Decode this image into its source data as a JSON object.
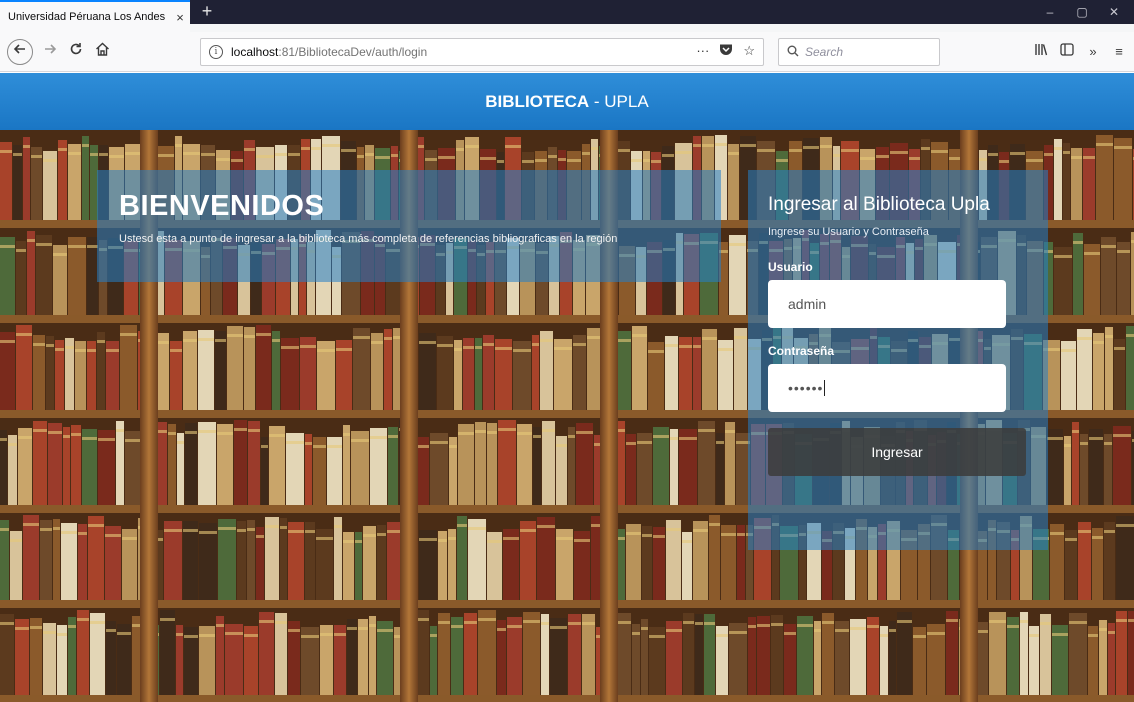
{
  "browser": {
    "tab_title": "Universidad Péruana Los Andes",
    "tab_close": "×",
    "new_tab": "+",
    "url_host": "localhost",
    "url_path": ":81/BibliotecaDev/auth/login",
    "url_menu": "···",
    "search_placeholder": "Search",
    "window_controls": {
      "minimize": "–",
      "restore": "▢",
      "close": "✕"
    }
  },
  "header": {
    "brand_bold": "BIBLIOTECA",
    "brand_rest": " - UPLA",
    "color": "#1f80d0"
  },
  "welcome": {
    "title": "BIENVENIDOS",
    "subtitle": "Ustesd esta a punto de ingresar a la biblioteca más completa de referencias bibliograficas en la región"
  },
  "login": {
    "title": "Ingresar al Biblioteca Upla",
    "subtitle": "Ingrese su Usuario y Contraseña",
    "username_label": "Usuario",
    "username_value": "admin",
    "password_label": "Contraseña",
    "password_value": "••••••",
    "submit_label": "Ingresar"
  }
}
